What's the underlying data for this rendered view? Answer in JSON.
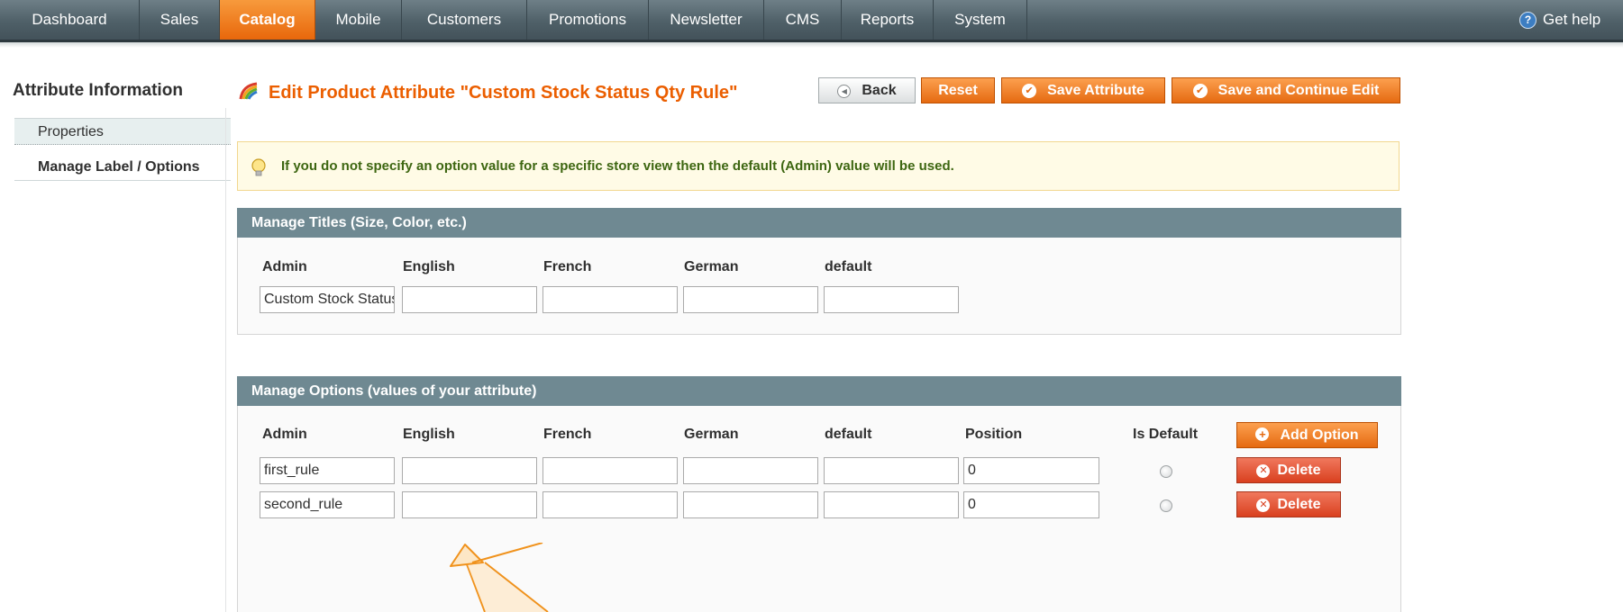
{
  "nav": {
    "items": [
      "Dashboard",
      "Sales",
      "Catalog",
      "Mobile",
      "Customers",
      "Promotions",
      "Newsletter",
      "CMS",
      "Reports",
      "System"
    ],
    "active_index": 2,
    "help_label": "Get help"
  },
  "sidebar": {
    "title": "Attribute Information",
    "tabs": [
      {
        "label": "Properties"
      },
      {
        "label": "Manage Label / Options",
        "active": true
      }
    ]
  },
  "header": {
    "title": "Edit Product Attribute \"Custom Stock Status Qty Rule\"",
    "buttons": {
      "back": "Back",
      "reset": "Reset",
      "save": "Save Attribute",
      "save_continue": "Save and Continue Edit"
    }
  },
  "notice": {
    "text": "If you do not specify an option value for a specific store view then the default (Admin) value will be used."
  },
  "titles_section": {
    "heading": "Manage Titles (Size, Color, etc.)",
    "columns": [
      "Admin",
      "English",
      "French",
      "German",
      "default"
    ],
    "values": [
      "Custom Stock Status Qty Rule",
      "",
      "",
      "",
      ""
    ]
  },
  "options_section": {
    "heading": "Manage Options (values of your attribute)",
    "columns": [
      "Admin",
      "English",
      "French",
      "German",
      "default",
      "Position",
      "Is Default"
    ],
    "add_button": "Add Option",
    "delete_label": "Delete",
    "rows": [
      {
        "admin": "first_rule",
        "english": "",
        "french": "",
        "german": "",
        "default": "",
        "position": "0",
        "is_default": false
      },
      {
        "admin": "second_rule",
        "english": "",
        "french": "",
        "german": "",
        "default": "",
        "position": "0",
        "is_default": false
      }
    ]
  },
  "colors": {
    "accent": "#eb5e00",
    "nav_bg": "#4f6068",
    "section_head": "#6f8992",
    "notice_bg": "#fffbe6",
    "delete_red": "#d9401f"
  }
}
